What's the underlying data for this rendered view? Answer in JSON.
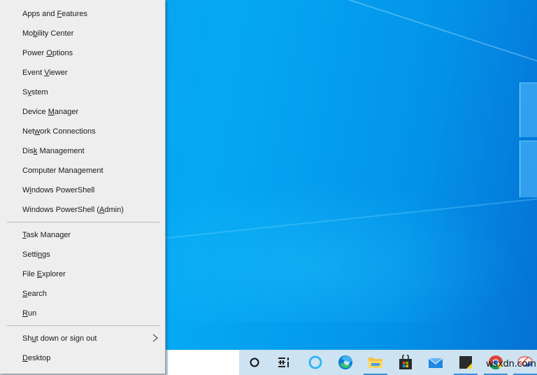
{
  "context_menu": {
    "groups": [
      {
        "items": [
          {
            "label": "Apps and Features",
            "access_key": "F"
          },
          {
            "label": "Mobility Center",
            "access_key": "b"
          },
          {
            "label": "Power Options",
            "access_key": "O"
          },
          {
            "label": "Event Viewer",
            "access_key": "V"
          },
          {
            "label": "System",
            "access_key": "y"
          },
          {
            "label": "Device Manager",
            "access_key": "M"
          },
          {
            "label": "Network Connections",
            "access_key": "w"
          },
          {
            "label": "Disk Management",
            "access_key": "k"
          },
          {
            "label": "Computer Management",
            "access_key": "g"
          },
          {
            "label": "Windows PowerShell",
            "access_key": "i"
          },
          {
            "label": "Windows PowerShell (Admin)",
            "access_key": "A"
          }
        ]
      },
      {
        "items": [
          {
            "label": "Task Manager",
            "access_key": "T"
          },
          {
            "label": "Settings",
            "access_key": "n"
          },
          {
            "label": "File Explorer",
            "access_key": "E"
          },
          {
            "label": "Search",
            "access_key": "S"
          },
          {
            "label": "Run",
            "access_key": "R"
          }
        ]
      },
      {
        "items": [
          {
            "label": "Shut down or sign out",
            "access_key": "u",
            "submenu": true,
            "submenu_icon": "chevron-right-icon"
          },
          {
            "label": "Desktop",
            "access_key": "D"
          }
        ]
      }
    ]
  },
  "taskbar": {
    "search_box_value": "",
    "icons": [
      {
        "name": "cortana-circle-icon",
        "running": false
      },
      {
        "name": "task-view-icon",
        "running": false
      },
      {
        "name": "cortana-app-icon",
        "running": false
      },
      {
        "name": "edge-icon",
        "running": false
      },
      {
        "name": "file-explorer-icon",
        "running": true
      },
      {
        "name": "microsoft-store-icon",
        "running": false
      },
      {
        "name": "mail-icon",
        "running": false
      },
      {
        "name": "sticky-notes-icon",
        "running": true
      },
      {
        "name": "chrome-icon",
        "running": true
      },
      {
        "name": "snipping-tool-icon",
        "running": true
      }
    ]
  },
  "watermark": "wsxdn.com",
  "colors": {
    "menu_background": "#eeeeee",
    "taskbar_background": "#cde3f1",
    "desktop_blue": "#06a8f3"
  }
}
